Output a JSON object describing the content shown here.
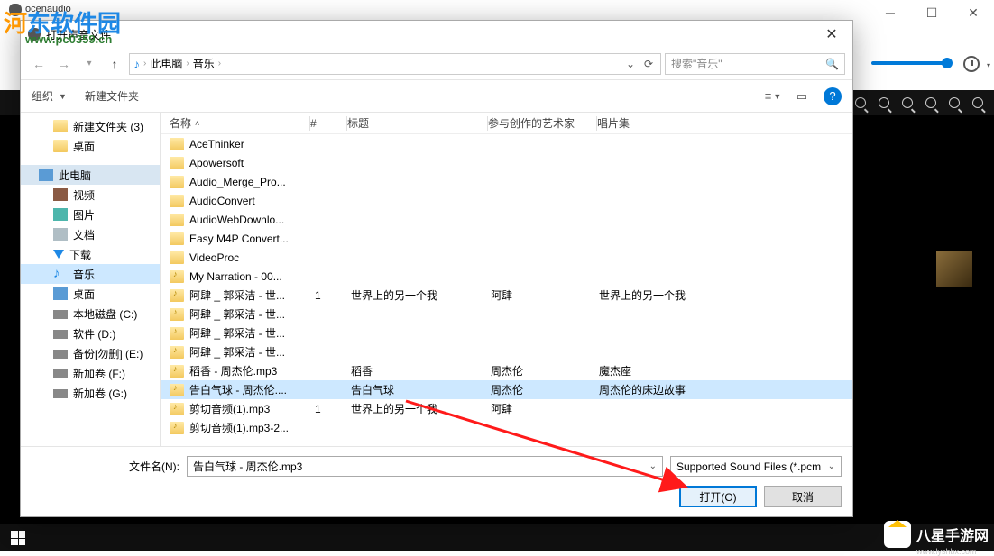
{
  "app": {
    "title": "ocenaudio"
  },
  "dialog": {
    "title": "打开声音文件",
    "breadcrumb": {
      "root": "此电脑",
      "folder": "音乐"
    },
    "search_placeholder": "搜索\"音乐\"",
    "organize": "组织",
    "new_folder": "新建文件夹",
    "nav": [
      {
        "label": "新建文件夹 (3)",
        "icon": "folder",
        "indent": true
      },
      {
        "label": "桌面",
        "icon": "folder",
        "indent": true
      },
      {
        "label": "此电脑",
        "icon": "pc",
        "indent": false,
        "sel": false,
        "hl": true
      },
      {
        "label": "视频",
        "icon": "video",
        "indent": true
      },
      {
        "label": "图片",
        "icon": "pic",
        "indent": true
      },
      {
        "label": "文档",
        "icon": "doc",
        "indent": true
      },
      {
        "label": "下载",
        "icon": "dl",
        "indent": true
      },
      {
        "label": "音乐",
        "icon": "music",
        "indent": true,
        "sel": true
      },
      {
        "label": "桌面",
        "icon": "desk",
        "indent": true
      },
      {
        "label": "本地磁盘 (C:)",
        "icon": "drive",
        "indent": true
      },
      {
        "label": "软件 (D:)",
        "icon": "drive",
        "indent": true
      },
      {
        "label": "备份[勿删] (E:)",
        "icon": "drive",
        "indent": true
      },
      {
        "label": "新加卷 (F:)",
        "icon": "drive",
        "indent": true
      },
      {
        "label": "新加卷 (G:)",
        "icon": "drive",
        "indent": true
      }
    ],
    "columns": {
      "name": "名称",
      "num": "#",
      "title": "标题",
      "artist": "参与创作的艺术家",
      "album": "唱片集"
    },
    "rows": [
      {
        "icon": "folder",
        "name": "AceThinker"
      },
      {
        "icon": "folder",
        "name": "Apowersoft"
      },
      {
        "icon": "folder",
        "name": "Audio_Merge_Pro..."
      },
      {
        "icon": "folder",
        "name": "AudioConvert"
      },
      {
        "icon": "folder",
        "name": "AudioWebDownlo..."
      },
      {
        "icon": "folder",
        "name": "Easy M4P Convert..."
      },
      {
        "icon": "folder",
        "name": "VideoProc"
      },
      {
        "icon": "mp3",
        "name": "My Narration - 00..."
      },
      {
        "icon": "mp3",
        "name": "阿肆 _ 郭采洁 - 世...",
        "num": "1",
        "title": "世界上的另一个我",
        "artist": "阿肆",
        "album": "世界上的另一个我"
      },
      {
        "icon": "mp3",
        "name": "阿肆 _ 郭采洁 - 世..."
      },
      {
        "icon": "mp3",
        "name": "阿肆 _ 郭采洁 - 世..."
      },
      {
        "icon": "mp3",
        "name": "阿肆 _ 郭采洁 - 世..."
      },
      {
        "icon": "mp3",
        "name": "稻香 - 周杰伦.mp3",
        "title": "稻香",
        "artist": "周杰伦",
        "album": "魔杰座"
      },
      {
        "icon": "mp3",
        "name": "告白气球 - 周杰伦....",
        "title": "告白气球",
        "artist": "周杰伦",
        "album": "周杰伦的床边故事",
        "sel": true
      },
      {
        "icon": "mp3",
        "name": "剪切音频(1).mp3",
        "num": "1",
        "title": "世界上的另一个我",
        "artist": "阿肆"
      },
      {
        "icon": "mp3",
        "name": "剪切音频(1).mp3-2..."
      }
    ],
    "filename_label": "文件名(N):",
    "filename_value": "告白气球 - 周杰伦.mp3",
    "filter": "Supported Sound Files (*.pcm",
    "open_btn": "打开(O)",
    "cancel_btn": "取消"
  },
  "watermark": {
    "brand": "河东软件园",
    "url": "www.pc0359.cn",
    "bx": "八星手游网",
    "bx_url": "www.lyshbx.com"
  }
}
